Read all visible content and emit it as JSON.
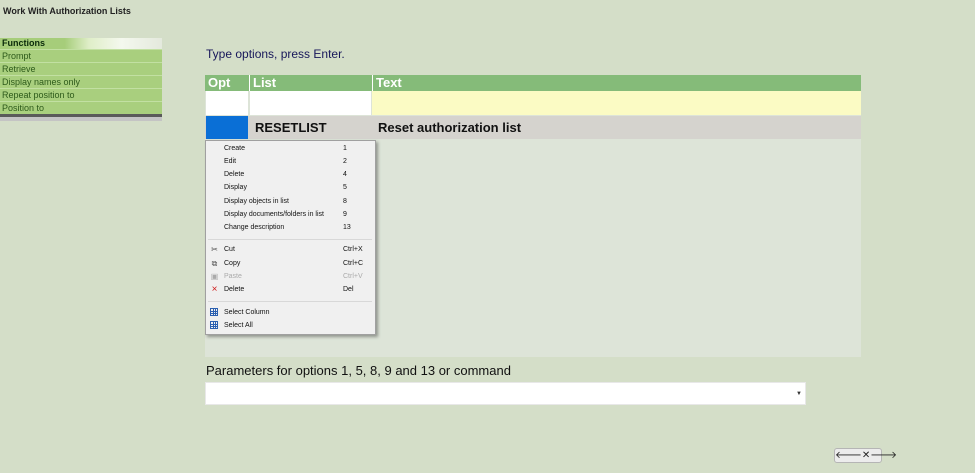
{
  "window": {
    "title": "Work With Authorization Lists"
  },
  "functions": {
    "header": "Functions",
    "items": [
      "Prompt",
      "Retrieve",
      "Display names only",
      "Repeat position to",
      "Position to"
    ]
  },
  "instructions": "Type options, press Enter.",
  "table": {
    "columns": [
      "Opt",
      "List",
      "Text"
    ],
    "rows": [
      {
        "opt": "",
        "list": "RESETLIST",
        "text": "Reset authorization list"
      }
    ]
  },
  "context_menu": {
    "options": [
      {
        "label": "Create",
        "shortcut": "1"
      },
      {
        "label": "Edit",
        "shortcut": "2"
      },
      {
        "label": "Delete",
        "shortcut": "4"
      },
      {
        "label": "Display",
        "shortcut": "5"
      },
      {
        "label": "Display objects in list",
        "shortcut": "8"
      },
      {
        "label": "Display documents/folders in list",
        "shortcut": "9"
      },
      {
        "label": "Change description",
        "shortcut": "13"
      }
    ],
    "edit": [
      {
        "label": "Cut",
        "shortcut": "Ctrl+X",
        "icon": "scissors-icon"
      },
      {
        "label": "Copy",
        "shortcut": "Ctrl+C",
        "icon": "copy-icon"
      },
      {
        "label": "Paste",
        "shortcut": "Ctrl+V",
        "icon": "paste-icon",
        "disabled": true
      },
      {
        "label": "Delete",
        "shortcut": "Del",
        "icon": "delete-icon"
      }
    ],
    "select": [
      {
        "label": "Select Column",
        "icon": "grid-icon"
      },
      {
        "label": "Select All",
        "icon": "grid-icon"
      }
    ]
  },
  "params": {
    "label": "Parameters for options 1, 5, 8, 9 and 13 or command",
    "value": ""
  },
  "nav": {
    "back": "back-arrow-icon",
    "close": "close-icon",
    "forward": "forward-arrow-icon"
  }
}
